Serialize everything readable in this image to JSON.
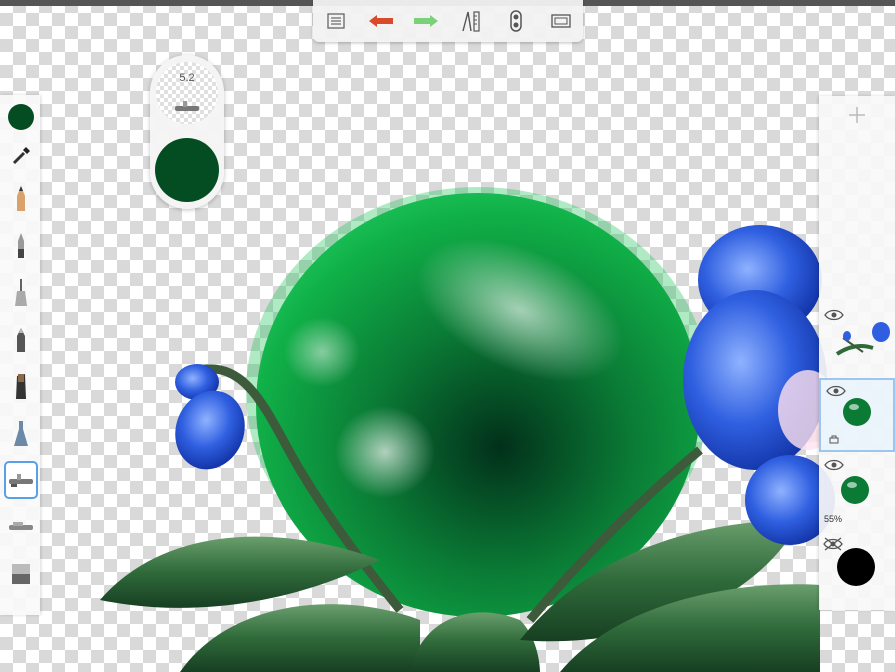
{
  "app": {
    "accent": "#5aa0e6"
  },
  "toolbar": {
    "items": [
      {
        "icon": "list-icon"
      },
      {
        "icon": "undo-arrow-icon",
        "color": "#d94a2b"
      },
      {
        "icon": "redo-arrow-icon",
        "color": "#7bd07b"
      },
      {
        "icon": "ruler-compass-icon"
      },
      {
        "icon": "symmetry-icon"
      },
      {
        "icon": "fullscreen-icon"
      }
    ]
  },
  "brush": {
    "size_label": "5.2",
    "color": "#044d22"
  },
  "tools": [
    {
      "icon": "color-swatch-icon"
    },
    {
      "icon": "eyedropper-icon"
    },
    {
      "icon": "pencil-icon"
    },
    {
      "icon": "ballpoint-pen-icon"
    },
    {
      "icon": "fineliner-icon"
    },
    {
      "icon": "marker-icon"
    },
    {
      "icon": "chisel-marker-icon"
    },
    {
      "icon": "paint-bottle-icon"
    },
    {
      "icon": "airbrush-icon",
      "selected": true
    },
    {
      "icon": "smudge-icon"
    },
    {
      "icon": "eraser-icon"
    }
  ],
  "layers": [
    {
      "name": "orchid-layer",
      "visible": true,
      "active": false,
      "opacity_label": ""
    },
    {
      "name": "sphere-layer",
      "visible": true,
      "active": true,
      "locked": true,
      "opacity_label": ""
    },
    {
      "name": "sphere-shadow-layer",
      "visible": true,
      "active": false,
      "opacity_label": "55%"
    }
  ],
  "background_layer": {
    "visible": false,
    "color": "#000000"
  }
}
